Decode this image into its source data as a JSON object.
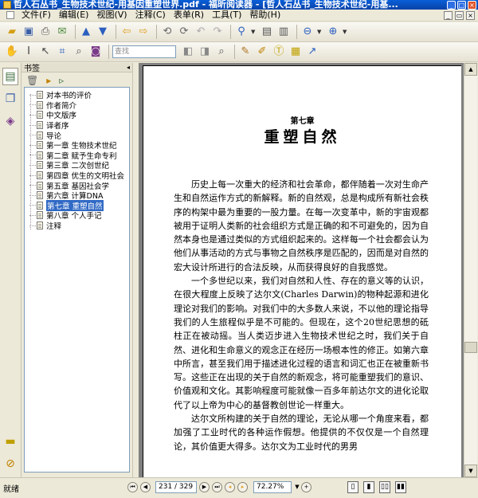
{
  "window": {
    "title": "哲人石丛书_生物技术世纪-用基因重塑世界.pdf - 福昕阅读器 - [哲人石丛书_生物技术世纪-用基...",
    "title_color": "#0a5fd8"
  },
  "menu": {
    "items": [
      "文件(F)",
      "编辑(E)",
      "视图(V)",
      "注释(C)",
      "表单(R)",
      "工具(T)",
      "帮助(H)"
    ]
  },
  "toolbar": {
    "search_placeholder": "查找"
  },
  "bookmarks": {
    "header": "书签",
    "items": [
      {
        "label": "对本书的评价",
        "selected": false
      },
      {
        "label": "作者简介",
        "selected": false
      },
      {
        "label": "中文版序",
        "selected": false
      },
      {
        "label": "译者序",
        "selected": false
      },
      {
        "label": "导论",
        "selected": false
      },
      {
        "label": "第一章 生物技术世纪",
        "selected": false
      },
      {
        "label": "第二章 赋予生命专利",
        "selected": false
      },
      {
        "label": "第三章 二次创世纪",
        "selected": false
      },
      {
        "label": "第四章 优生的文明社会",
        "selected": false
      },
      {
        "label": "第五章 基因社会学",
        "selected": false
      },
      {
        "label": "第六章 计算DNA",
        "selected": false
      },
      {
        "label": "第七章 重塑自然",
        "selected": true
      },
      {
        "label": "第八章 个人手记",
        "selected": false
      },
      {
        "label": "注释",
        "selected": false
      }
    ]
  },
  "document": {
    "chapter_number": "第七章",
    "chapter_title": "重塑自然",
    "paragraphs": [
      "历史上每一次重大的经济和社会革命，都伴随着一次对生命产生和自然运作方式的新解释。新的自然观，总是构成所有新社会秩序的构架中最为重要的一股力量。在每一次变革中，新的宇宙观都被用于证明人类新的社会组织方式是正确的和不可避免的，因为自然本身也是通过类似的方式组织起来的。这样每一个社会都会认为他们从事活动的方式与事物之自然秩序是匹配的，因而是对自然的宏大设计所进行的合法反映，从而获得良好的自我感觉。",
      "一个多世纪以来，我们对自然和人性、存在的意义等的认识，在很大程度上反映了达尔文(Charles Darwin)的物种起源和进化理论对我们的影响。对我们中的大多数人来说，不以他的理论指导我们的人生旅程似乎是不可能的。但现在，这个20世纪思想的砥柱正在被动摇。当人类迈步进入生物技术世纪之时，我们关于自然、进化和生命意义的观念正在经历一场根本性的修正。如第六章中所言，甚至我们用于描述进化过程的语言和词汇也正在被重新书写。这些正在出现的关于自然的新观念，将可能重塑我们的意识、价值观和文化。其影响程度可能就像一百多年前达尔文的进化论取代了以上帝为中心的基督教创世论一样重大。",
      "达尔文所构建的关于自然的理论，无论从哪一个角度来看，都加强了工业时代的各种运作假想。他提供的不仅仅是一个自然理论，其价值更大得多。达尔文为工业时代的男男"
    ]
  },
  "status": {
    "ready_text": "就绪",
    "page_indicator": "231 / 329",
    "current_page": 231,
    "total_pages": 329,
    "zoom": "72.27%"
  }
}
